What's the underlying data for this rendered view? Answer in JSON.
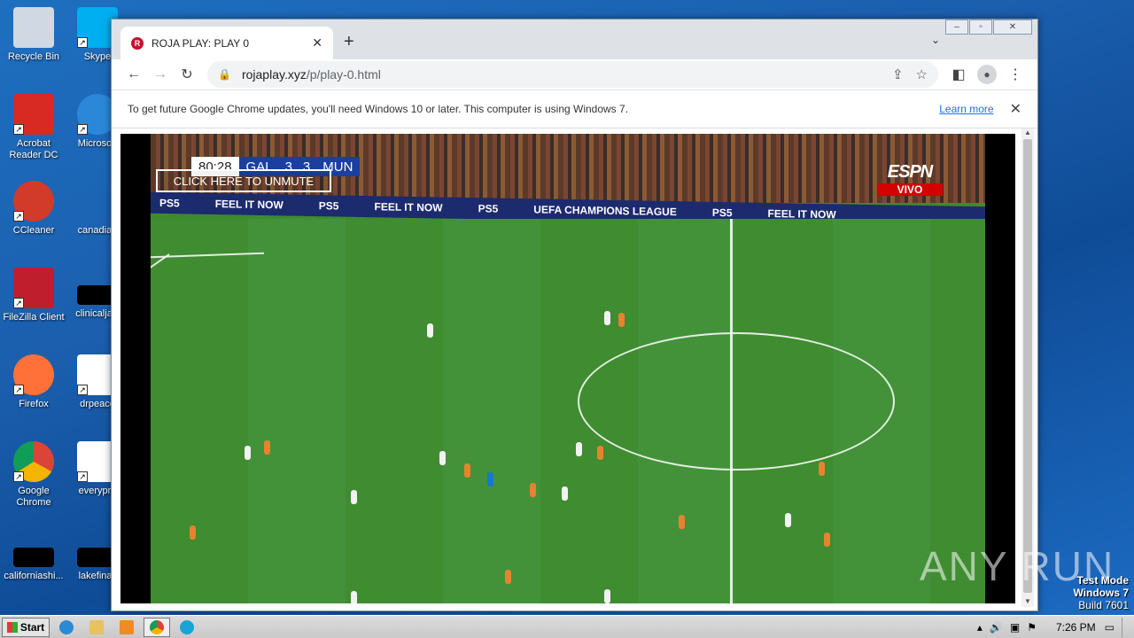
{
  "desktop": {
    "icons": [
      {
        "label": "Recycle Bin",
        "color": "#cfd8e3"
      },
      {
        "label": "Skype",
        "color": "#00aff0"
      },
      {
        "label": "Acrobat Reader DC",
        "color": "#d82a22"
      },
      {
        "label": "Microsoft",
        "color": "#2b88d8"
      },
      {
        "label": "CCleaner",
        "color": "#d23a2a"
      },
      {
        "label": "canadian",
        "color": "#1f5fae"
      },
      {
        "label": "FileZilla Client",
        "color": "#bf1e2d"
      },
      {
        "label": "clinicaljacl",
        "color": "#000000"
      },
      {
        "label": "Firefox",
        "color": "#ff7139"
      },
      {
        "label": "drpeace",
        "color": "#ffffff"
      },
      {
        "label": "Google Chrome",
        "color": "#4caf50"
      },
      {
        "label": "everypre",
        "color": "#ffffff"
      },
      {
        "label": "californiashi...",
        "color": "#000000"
      },
      {
        "label": "lakefinall",
        "color": "#000000"
      }
    ]
  },
  "browser": {
    "tab": {
      "title": "ROJA PLAY: PLAY 0",
      "favicon": "R"
    },
    "url_host": "rojaplay.xyz",
    "url_path": "/p/play-0.html",
    "infobar": {
      "message": "To get future Google Chrome updates, you'll need Windows 10 or later. This computer is using Windows 7.",
      "link": "Learn more"
    }
  },
  "video": {
    "time": "80:28",
    "home_team": "GAL",
    "home_score": "3",
    "away_score": "3",
    "away_team": "MUN",
    "unmute_label": "CLICK HERE TO UNMUTE",
    "broadcaster": "ESPN",
    "live_label": "VIVO",
    "ads": [
      "PS5",
      "FEEL IT NOW",
      "PS5",
      "FEEL IT NOW",
      "PS5",
      "UEFA CHAMPIONS LEAGUE",
      "PS5",
      "FEEL IT NOW"
    ]
  },
  "watermark": "ANY RUN",
  "os": {
    "mode_line1": "Test Mode",
    "mode_line2": "Windows 7",
    "build": "Build 7601",
    "start_label": "Start",
    "clock": "7:26 PM"
  },
  "colors": {
    "accent": "#1a73e8",
    "desktop": "#1b5fae",
    "live": "#d50000"
  }
}
